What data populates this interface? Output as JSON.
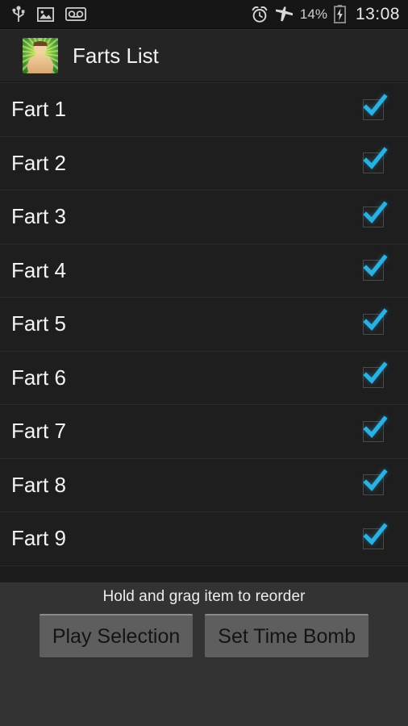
{
  "status_bar": {
    "left_icons": [
      {
        "name": "usb-icon",
        "label": "USB connected"
      },
      {
        "name": "image-icon",
        "label": "Screenshot captured"
      },
      {
        "name": "voicemail-icon",
        "label": "Voicemail"
      }
    ],
    "right_icons": [
      {
        "name": "alarm-icon",
        "label": "Alarm set"
      },
      {
        "name": "airplane-mode-icon",
        "label": "Airplane mode"
      }
    ],
    "battery_percent": "14%",
    "battery_state": "charging",
    "clock": "13:08"
  },
  "header": {
    "title": "Farts List",
    "icon_name": "app-icon-fat-man"
  },
  "list": {
    "items": [
      {
        "label": "Fart 1",
        "checked": true
      },
      {
        "label": "Fart 2",
        "checked": true
      },
      {
        "label": "Fart 3",
        "checked": true
      },
      {
        "label": "Fart 4",
        "checked": true
      },
      {
        "label": "Fart 5",
        "checked": true
      },
      {
        "label": "Fart 6",
        "checked": true
      },
      {
        "label": "Fart 7",
        "checked": true
      },
      {
        "label": "Fart 8",
        "checked": true
      },
      {
        "label": "Fart 9",
        "checked": true
      }
    ]
  },
  "bottom_panel": {
    "hint": "Hold and grag item to reorder",
    "buttons": [
      {
        "label": "Play Selection",
        "name": "play-selection-button"
      },
      {
        "label": "Set Time Bomb",
        "name": "set-time-bomb-button"
      }
    ]
  },
  "colors": {
    "accent_check": "#2bb0e0",
    "status_bar_bg": "#161616",
    "header_bg": "#242424",
    "list_bg": "#1e1e1e",
    "panel_bg": "#333333",
    "button_bg": "#5e5e5e"
  }
}
